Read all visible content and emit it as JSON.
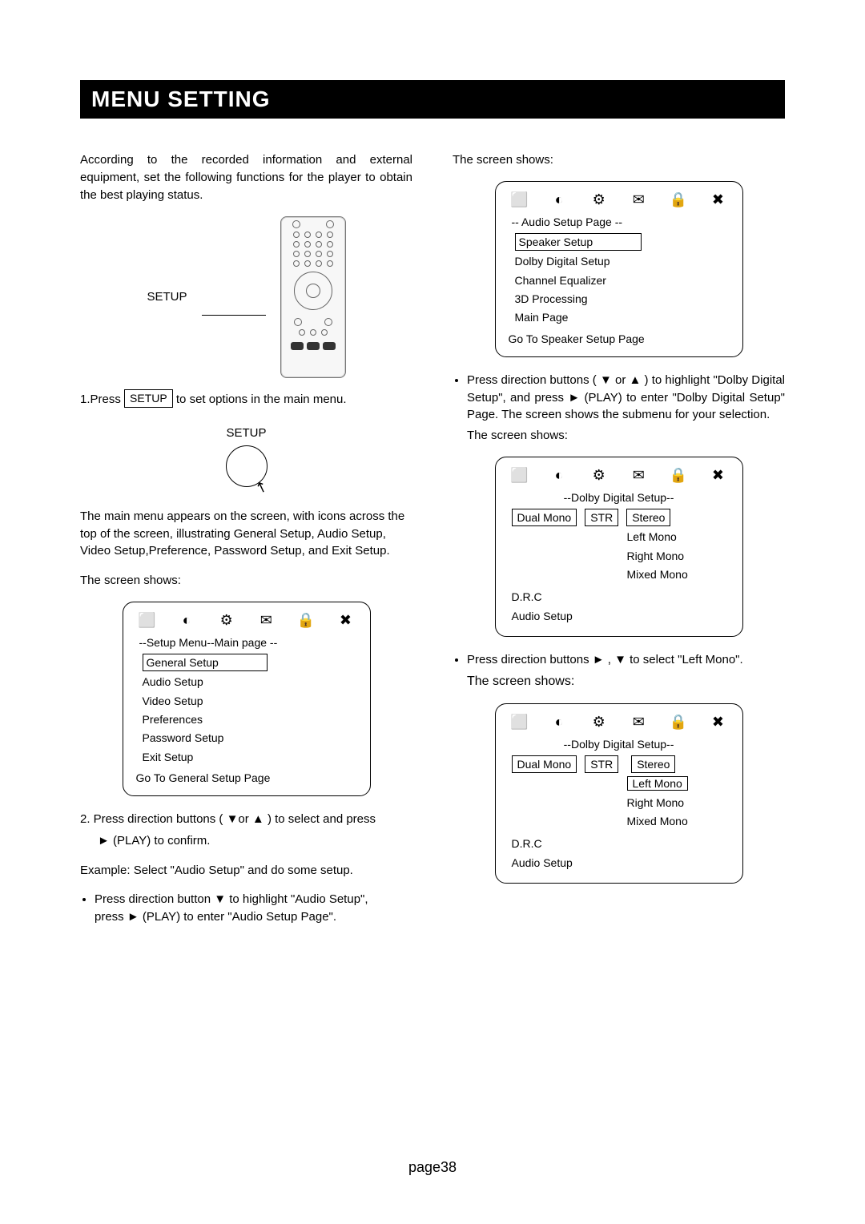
{
  "title": "MENU SETTING",
  "left": {
    "intro": "According to the recorded information and external equipment, set the following functions  for  the player to obtain the best playing status.",
    "remote_label": "SETUP",
    "step1_pre": "1.Press ",
    "step1_boxed": "SETUP",
    "step1_post": " to set options in the main menu.",
    "hand_label": "SETUP",
    "main_menu_desc": "The main menu appears on the screen, with icons across the top of the screen, illustrating General Setup, Audio Setup, Video Setup,Preference, Password Setup, and Exit Setup.",
    "screen_shows": "The screen shows:",
    "osd_main": {
      "header": "--Setup Menu--Main page --",
      "selected": "General Setup",
      "items": [
        "Audio Setup",
        "Video Setup",
        "Preferences",
        "Password Setup",
        "Exit Setup"
      ],
      "footer": "Go To General Setup Page"
    },
    "step2": "2. Press direction buttons ( ▼or ▲ ) to select and press",
    "step2b": "► (PLAY) to confirm.",
    "example": "Example: Select \"Audio Setup\" and do some setup.",
    "bullet1a": "Press direction button  ▼  to highlight \"Audio Setup\",",
    "bullet1b": "press  ►  (PLAY) to enter \"Audio Setup Page\"."
  },
  "right": {
    "screen_shows": "The screen shows:",
    "osd_audio": {
      "header": "-- Audio Setup Page --",
      "selected": "Speaker Setup",
      "items": [
        "Dolby Digital Setup",
        "Channel Equalizer",
        "3D Processing",
        "Main Page"
      ],
      "footer": "Go To Speaker Setup Page"
    },
    "dolby_para": "Press direction buttons ( ▼  or ▲ ) to highlight \"Dolby Digital Setup\", and press ► (PLAY) to enter \"Dolby Digital Setup\" Page. The screen shows the submenu for your selection.",
    "screen_shows2": "The screen shows:",
    "osd_dolby1": {
      "header": "--Dolby Digital Setup--",
      "left_sel": "Dual Mono",
      "mid_sel": "STR",
      "right_sel": "Stereo",
      "right_items": [
        "Left Mono",
        "Right Mono",
        "Mixed Mono"
      ],
      "left_items": [
        "D.R.C",
        "Audio Setup"
      ]
    },
    "bullet2": "Press direction buttons ► , ▼ to select \"Left Mono\".",
    "screen_shows3": "The screen shows:",
    "osd_dolby2": {
      "header": "--Dolby Digital Setup--",
      "left_sel": "Dual Mono",
      "mid_sel": "STR",
      "right_items_pre": "Stereo",
      "right_sel": "Left Mono",
      "right_items_post": [
        "Right Mono",
        "Mixed Mono"
      ],
      "left_items": [
        "D.R.C",
        "Audio Setup"
      ]
    }
  },
  "page_number": "page38",
  "icons": [
    "⬜",
    "◐",
    "⚙",
    "✉",
    "🔒",
    "✖"
  ]
}
